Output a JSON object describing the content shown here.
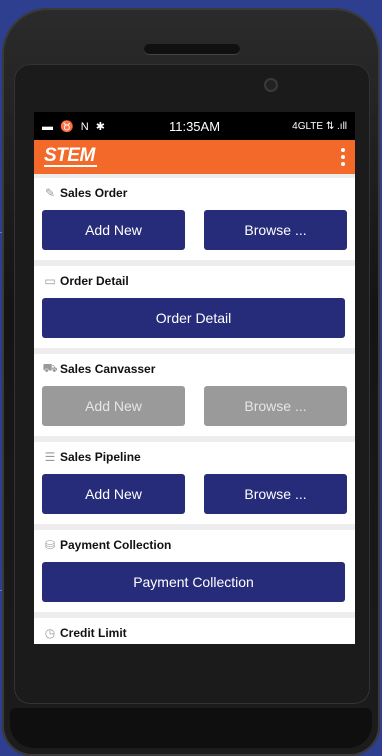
{
  "status_bar": {
    "left": "▬ ♉ N ✱",
    "time": "11:35AM",
    "right": "4GLTE ⇅ .ıll"
  },
  "app": {
    "logo": "STEM"
  },
  "sections": [
    {
      "title": "Sales Order",
      "icon": "edit-icon",
      "buttons": [
        "Add New",
        "Browse ..."
      ]
    },
    {
      "title": "Order Detail",
      "icon": "document-icon",
      "buttons": [
        "Order Detail"
      ]
    },
    {
      "title": "Sales Canvasser",
      "icon": "truck-icon",
      "buttons": [
        "Add New",
        "Browse ..."
      ]
    },
    {
      "title": "Sales Pipeline",
      "icon": "pipeline-icon",
      "buttons": [
        "Add New",
        "Browse ..."
      ]
    },
    {
      "title": "Payment Collection",
      "icon": "payment-icon",
      "buttons": [
        "Payment Collection"
      ]
    },
    {
      "title": "Credit Limit",
      "icon": "clock-icon",
      "buttons": []
    }
  ],
  "colors": {
    "appbar": "#f2692a",
    "button_primary": "#272c7a",
    "button_disabled": "#9a9a9a"
  }
}
